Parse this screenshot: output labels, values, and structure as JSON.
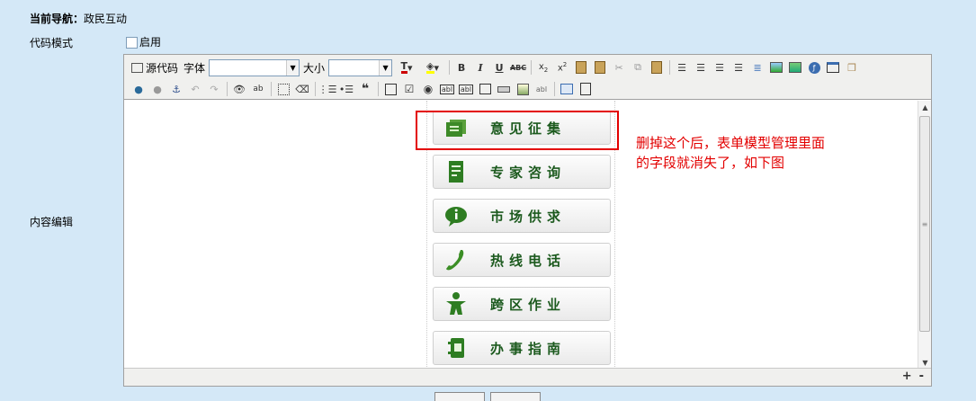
{
  "nav": {
    "prefix": "当前导航：",
    "current": "政民互动"
  },
  "form": {
    "code_mode_label": "代码模式",
    "enable_label": "启用",
    "content_label": "内容编辑"
  },
  "toolbar": {
    "source_label": "源代码",
    "font_label": "字体",
    "size_label": "大小",
    "font_value": "",
    "size_value": ""
  },
  "menu": {
    "items": [
      {
        "label": "意见征集",
        "icon": "document-stack-icon"
      },
      {
        "label": "专家咨询",
        "icon": "form-icon"
      },
      {
        "label": "市场供求",
        "icon": "info-bubble-icon"
      },
      {
        "label": "热线电话",
        "icon": "phone-icon"
      },
      {
        "label": "跨区作业",
        "icon": "person-icon"
      },
      {
        "label": "办事指南",
        "icon": "guide-book-icon"
      }
    ]
  },
  "annotation": {
    "line1": "删掉这个后，表单模型管理里面",
    "line2": "的字段就消失了，如下图"
  },
  "colors": {
    "annotation_red": "#e30000",
    "menu_green": "#1c5a1e",
    "page_bg": "#d4e8f7"
  },
  "statusbar": {
    "zoom_in": "+",
    "zoom_out": "-"
  }
}
